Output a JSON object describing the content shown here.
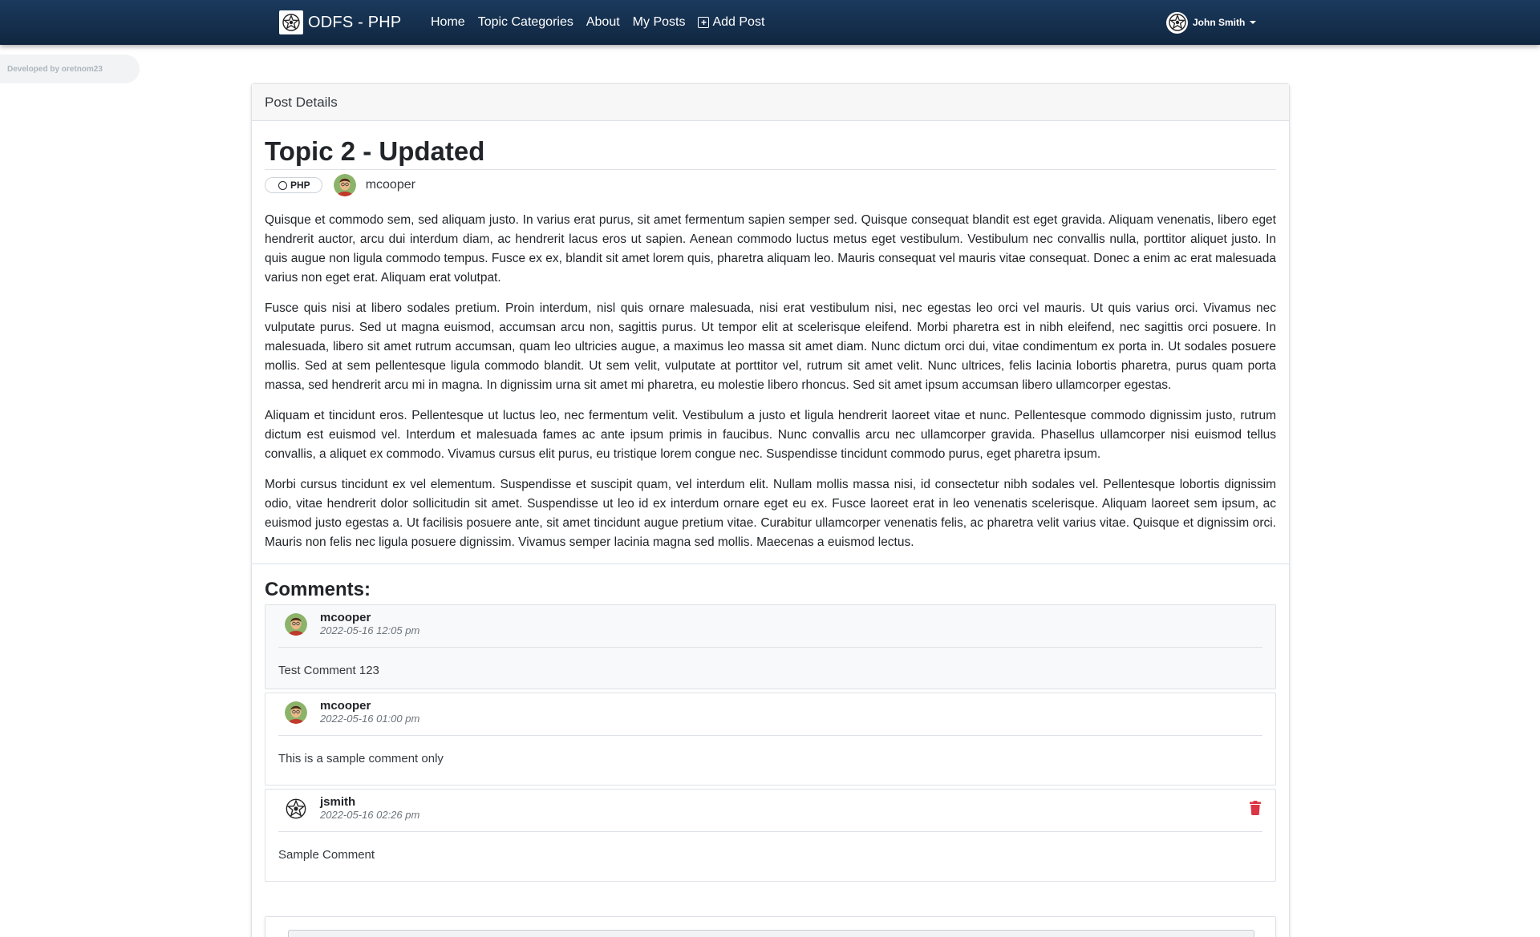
{
  "navbar": {
    "brand": "ODFS - PHP",
    "links": [
      "Home",
      "Topic Categories",
      "About",
      "My Posts"
    ],
    "add_post": "Add Post",
    "user_name": "John Smith"
  },
  "dev_badge": "Developed by oretnom23",
  "card": {
    "header": "Post Details"
  },
  "post": {
    "title": "Topic 2 - Updated",
    "topic": "PHP",
    "author": "mcooper",
    "paragraphs": [
      "Quisque et commodo sem, sed aliquam justo. In varius erat purus, sit amet fermentum sapien semper sed. Quisque consequat blandit est eget gravida. Aliquam venenatis, libero eget hendrerit auctor, arcu dui interdum diam, ac hendrerit lacus eros ut sapien. Aenean commodo luctus metus eget vestibulum. Vestibulum nec convallis nulla, porttitor aliquet justo. In quis augue non ligula commodo tempus. Fusce ex ex, blandit sit amet lorem quis, pharetra aliquam leo. Mauris consequat vel mauris vitae consequat. Donec a enim ac erat malesuada varius non eget erat. Aliquam erat volutpat.",
      "Fusce quis nisi at libero sodales pretium. Proin interdum, nisl quis ornare malesuada, nisi erat vestibulum nisi, nec egestas leo orci vel mauris. Ut quis varius orci. Vivamus nec vulputate purus. Sed ut magna euismod, accumsan arcu non, sagittis purus. Ut tempor elit at scelerisque eleifend. Morbi pharetra est in nibh eleifend, nec sagittis orci posuere. In malesuada, libero sit amet rutrum accumsan, quam leo ultricies augue, a maximus leo massa sit amet diam. Nunc dictum orci dui, vitae condimentum ex porta in. Ut sodales posuere mollis. Sed at sem pellentesque ligula commodo blandit. Ut sem velit, vulputate at porttitor vel, rutrum sit amet velit. Nunc ultrices, felis lacinia lobortis pharetra, purus quam porta massa, sed hendrerit arcu mi in magna. In dignissim urna sit amet mi pharetra, eu molestie libero rhoncus. Sed sit amet ipsum accumsan libero ullamcorper egestas.",
      "Aliquam et tincidunt eros. Pellentesque ut luctus leo, nec fermentum velit. Vestibulum a justo et ligula hendrerit laoreet vitae et nunc. Pellentesque commodo dignissim justo, rutrum dictum est euismod vel. Interdum et malesuada fames ac ante ipsum primis in faucibus. Nunc convallis arcu nec ullamcorper gravida. Phasellus ullamcorper nisi euismod tellus convallis, a aliquet ex commodo. Vivamus cursus elit purus, eu tristique lorem congue nec. Suspendisse tincidunt commodo purus, eget pharetra ipsum.",
      "Morbi cursus tincidunt ex vel elementum. Suspendisse et suscipit quam, vel interdum elit. Nullam mollis massa nisi, id consectetur nibh sodales vel. Pellentesque lobortis dignissim odio, vitae hendrerit dolor sollicitudin sit amet. Suspendisse ut leo id ex interdum ornare eget eu ex. Fusce laoreet erat in leo venenatis scelerisque. Aliquam laoreet sem ipsum, ac euismod justo egestas a. Ut facilisis posuere ante, sit amet tincidunt augue pretium vitae. Curabitur ullamcorper venenatis felis, ac pharetra velit varius vitae. Quisque et dignissim orci. Mauris non felis nec ligula posuere dignissim. Vivamus semper lacinia magna sed mollis. Maecenas a euismod lectus."
    ]
  },
  "comments": {
    "title": "Comments:",
    "items": [
      {
        "user": "mcooper",
        "date": "2022-05-16 12:05 pm",
        "text": "Test Comment 123"
      },
      {
        "user": "mcooper",
        "date": "2022-05-16 01:00 pm",
        "text": "This is a sample comment only"
      },
      {
        "user": "jsmith",
        "date": "2022-05-16 02:26 pm",
        "text": "Sample Comment"
      }
    ]
  },
  "colors": {
    "navbar": "#1b3a5e",
    "danger": "#dc3545"
  }
}
